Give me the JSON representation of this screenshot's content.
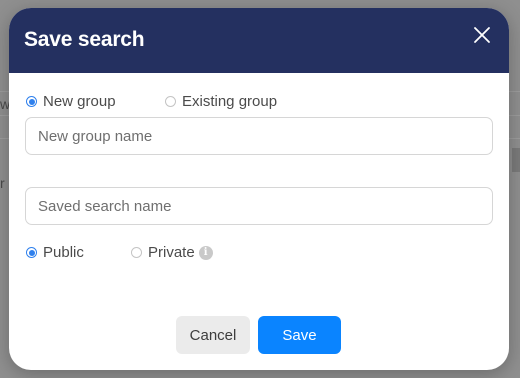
{
  "dialog": {
    "title": "Save search",
    "close_icon": "close-icon"
  },
  "group_choice": {
    "new_group_label": "New group",
    "existing_group_label": "Existing group",
    "selected": "new_group"
  },
  "new_group_name": {
    "placeholder": "New group name",
    "value": ""
  },
  "saved_search_name": {
    "placeholder": "Saved search name",
    "value": ""
  },
  "visibility": {
    "public_label": "Public",
    "private_label": "Private",
    "selected": "public",
    "info_icon": "info-icon",
    "info_glyph": "i"
  },
  "actions": {
    "cancel_label": "Cancel",
    "save_label": "Save"
  },
  "background": {
    "partial_text_1": "w",
    "partial_text_2": "r"
  },
  "colors": {
    "header": "#243060",
    "accent": "#0a84ff",
    "radio_selected": "#2f80ed"
  }
}
